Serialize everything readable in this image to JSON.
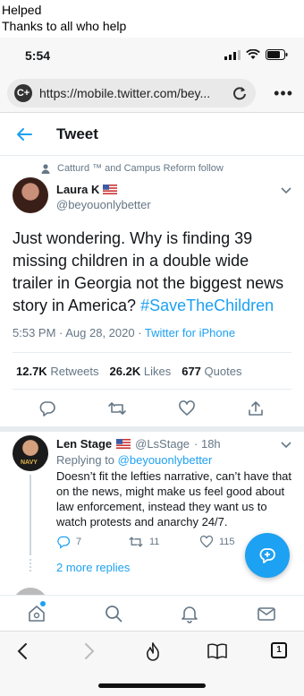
{
  "caption": [
    "Helped",
    "Thanks to all who help"
  ],
  "status_bar": {
    "time": "5:54"
  },
  "browser": {
    "site_icon_label": "C+",
    "url": "https://mobile.twitter.com/bey..."
  },
  "header": {
    "title": "Tweet"
  },
  "tweet": {
    "social_context": "Catturd ™ and Campus Reform follow",
    "author_name": "Laura K",
    "author_handle": "@beyouonlybetter",
    "text_plain": "Just wondering. Why is finding 39 missing children in a double wide trailer in Georgia not the biggest news story in America? ",
    "hashtag": "#SaveTheChildren",
    "timestamp": "5:53 PM · Aug 28, 2020 · ",
    "client": "Twitter for iPhone",
    "retweets_count": "12.7K",
    "retweets_label": "Retweets",
    "likes_count": "26.2K",
    "likes_label": "Likes",
    "quotes_count": "677",
    "quotes_label": "Quotes"
  },
  "reply": {
    "name": "Len Stage",
    "handle": "@LsStage",
    "time": "· 18h",
    "replying_prefix": "Replying to ",
    "replying_handle": "@beyouonlybetter",
    "text": "Doesn’t fit the lefties narrative, can’t have that on the news, might make us feel good about law enforcement, instead they want us to watch protests and anarchy 24/7.",
    "reply_count": "7",
    "retweet_count": "11",
    "like_count": "115",
    "more_replies": "2 more replies",
    "avatar_text": "NAVY"
  },
  "colors": {
    "accent": "#1da1f2",
    "secondary_text": "#657786",
    "text": "#14171a",
    "divider": "#e6ecf0"
  },
  "icons": [
    "back-arrow-icon",
    "caret-down-icon",
    "reply-icon",
    "retweet-icon",
    "like-icon",
    "share-icon",
    "compose-icon",
    "home-icon",
    "search-icon",
    "notifications-icon",
    "messages-icon",
    "safari-back-icon",
    "safari-forward-icon",
    "brave-flame-icon",
    "bookmarks-icon",
    "tabs-icon"
  ],
  "safari": {
    "tab_count": "1"
  }
}
